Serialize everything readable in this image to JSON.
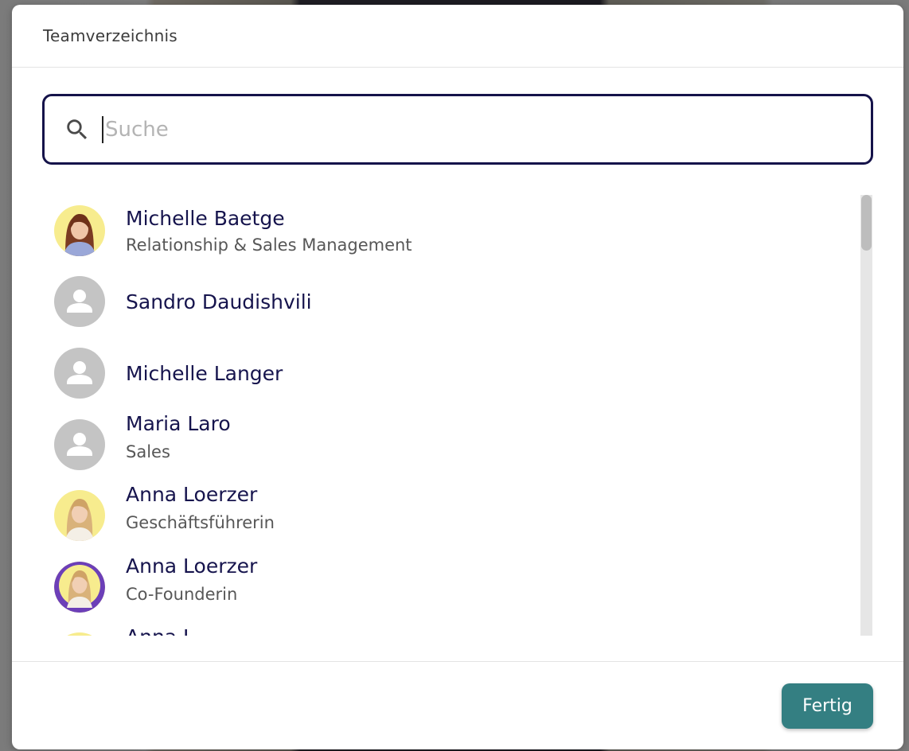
{
  "dialog": {
    "title": "Teamverzeichnis"
  },
  "search": {
    "placeholder": "Suche",
    "value": ""
  },
  "members": [
    {
      "name": "Michelle Baetge",
      "role": "Relationship & Sales Management",
      "avatar": "photo"
    },
    {
      "name": "Sandro Daudishvili",
      "role": "",
      "avatar": "person-placeholder-icon"
    },
    {
      "name": "Michelle Langer",
      "role": "",
      "avatar": "person-placeholder-icon"
    },
    {
      "name": "Maria Laro",
      "role": "Sales",
      "avatar": "person-placeholder-icon"
    },
    {
      "name": "Anna Loerzer",
      "role": "Geschäftsführerin",
      "avatar": "photo"
    },
    {
      "name": "Anna Loerzer",
      "role": "Co-Founderin",
      "avatar": "photo-hiring-badge"
    },
    {
      "name": "Anna L",
      "role": "",
      "avatar": "photo"
    }
  ],
  "footer": {
    "done_label": "Fertig"
  },
  "colors": {
    "accent": "#347f82",
    "name_text": "#16144d",
    "search_border": "#15134a",
    "avatar_placeholder": "#c4c4c4",
    "avatar_photo_bg": "#f7ec8e",
    "hiring_badge": "#6c3fb8"
  }
}
